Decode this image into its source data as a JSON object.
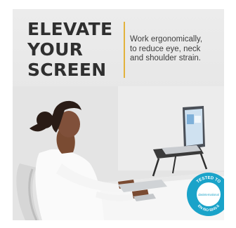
{
  "headline": {
    "line1": "ELEVATE",
    "line2": "YOUR",
    "line3": "SCREEN"
  },
  "tagline": {
    "line1": "Work ergonomically,",
    "line2": "to reduce eye, neck",
    "line3": "and shoulder strain."
  },
  "badge": {
    "top_text": "TESTED TO",
    "brand": "dasinternational",
    "standard": "EN ISO 9241-5"
  },
  "colors": {
    "accent": "#e2b23c",
    "badge": "#1aa3c9",
    "headline": "#2f2f2f"
  }
}
